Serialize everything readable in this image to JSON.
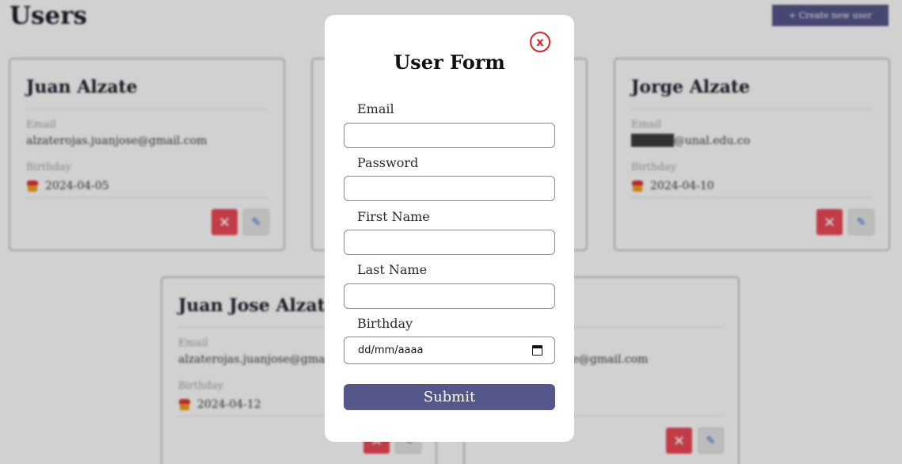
{
  "page": {
    "title": "Users",
    "create_button": "+ Create new user"
  },
  "cards": [
    {
      "name": "Juan Alzate",
      "email_label": "Email",
      "email": "alzaterojas.juanjose@gmail.com",
      "birthday_label": "Birthday",
      "birthday": "2024-04-05",
      "delete_icon": "×",
      "edit_icon": "✎"
    },
    {
      "name": "",
      "email_label": "",
      "email": "",
      "birthday_label": "",
      "birthday": "",
      "delete_icon": "×",
      "edit_icon": "✎"
    },
    {
      "name": "Jorge Alzate",
      "email_label": "Email",
      "email": "█████@unal.edu.co",
      "birthday_label": "Birthday",
      "birthday": "2024-04-10",
      "delete_icon": "×",
      "edit_icon": "✎"
    },
    {
      "name": "Juan Jose Alzate R",
      "email_label": "Email",
      "email": "alzaterojas.juanjose@gmail.com",
      "birthday_label": "Birthday",
      "birthday": "2024-04-12",
      "delete_icon": "×",
      "edit_icon": "✎"
    },
    {
      "name": "",
      "email_label": "",
      "email": "ose@gmail.com",
      "birthday_label": "",
      "birthday": "",
      "delete_icon": "×",
      "edit_icon": "✎"
    }
  ],
  "modal": {
    "close_label": "x",
    "title": "User Form",
    "fields": {
      "email_label": "Email",
      "password_label": "Password",
      "first_name_label": "First Name",
      "last_name_label": "Last Name",
      "birthday_label": "Birthday",
      "birthday_placeholder": "dd/mm/aaaa"
    },
    "submit_label": "Submit"
  },
  "colors": {
    "accent": "#55568a",
    "danger": "#ed4a57",
    "close": "#e02424"
  },
  "icons": {
    "cake": "cake-icon",
    "delete": "x-icon",
    "edit": "pencil-icon",
    "calendar": "calendar-icon"
  }
}
